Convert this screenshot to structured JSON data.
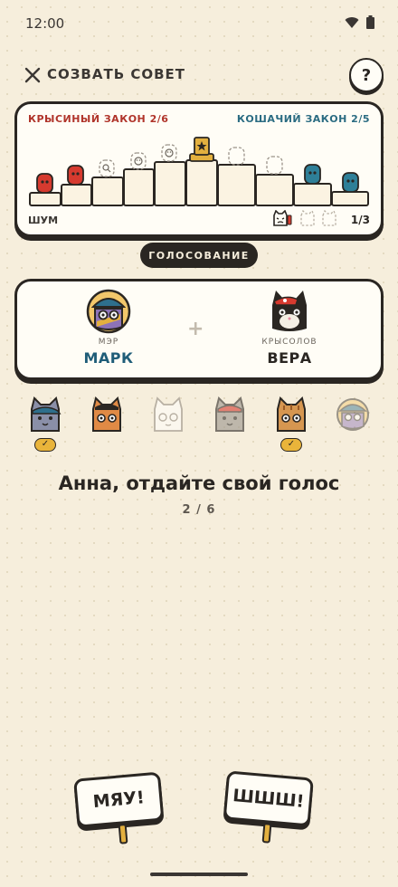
{
  "status_bar": {
    "time": "12:00"
  },
  "header": {
    "title": "СОЗВАТЬ СОВЕТ",
    "help_label": "?"
  },
  "board": {
    "rat_law": "КРЫСИНЫЙ ЗАКОН 2/6",
    "cat_law": "КОШАЧИЙ ЗАКОН 2/5",
    "noise_label": "ШУМ",
    "noise_count": "1/3",
    "colors": {
      "rat": "#d63a2f",
      "cat": "#2e7f98",
      "gold": "#e3b03f"
    }
  },
  "voting_label": "ГОЛОСОВАНИЕ",
  "proposal": {
    "left": {
      "role": "МЭР",
      "name": "МАРК",
      "color": "#1f5d78"
    },
    "plus": "+",
    "right": {
      "role": "КРЫСОЛОВ",
      "name": "ВЕРА",
      "color": "#2a2622"
    }
  },
  "players": [
    {
      "avatar": "cat-blue-cap",
      "voted": true
    },
    {
      "avatar": "cat-orange-glasses",
      "voted": false
    },
    {
      "avatar": "cat-white-ghost",
      "voted": false
    },
    {
      "avatar": "cat-gray-red-cap",
      "voted": false
    },
    {
      "avatar": "cat-orange-tabby",
      "voted": true
    },
    {
      "avatar": "cat-mayor-faded",
      "voted": false
    }
  ],
  "check_mark": "✓",
  "prompt": "Анна, отдайте свой голос",
  "progress": "2 / 6",
  "buttons": {
    "meow": "МЯУ!",
    "shh": "ШШШ!"
  }
}
